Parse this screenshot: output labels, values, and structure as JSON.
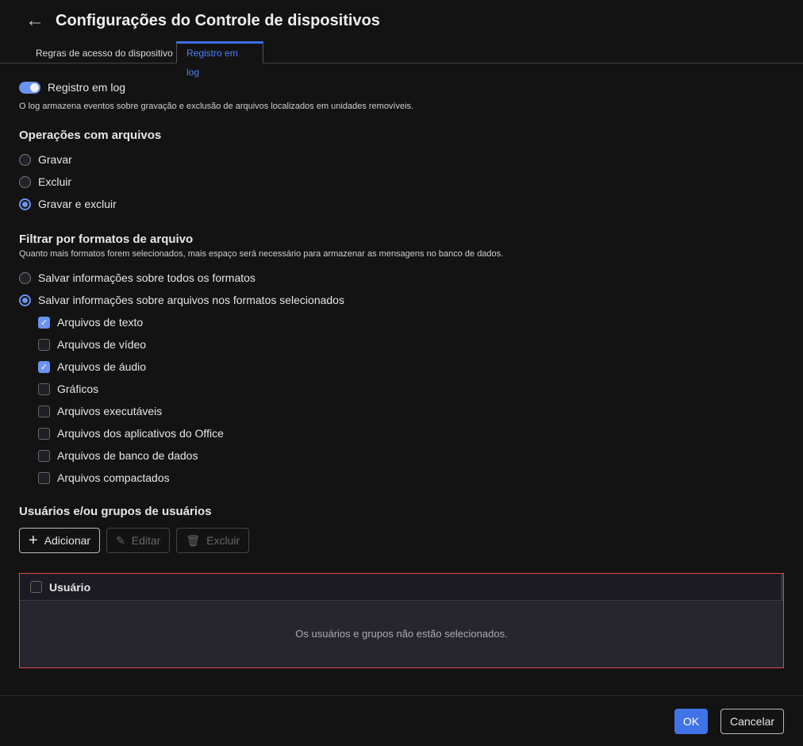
{
  "header": {
    "title": "Configurações do Controle de dispositivos"
  },
  "tabs": [
    {
      "label": "Regras de acesso do dispositivo"
    },
    {
      "label": "Registro em log"
    }
  ],
  "logging": {
    "toggle_label": "Registro em log",
    "enabled": true,
    "description": "O log armazena eventos sobre gravação e exclusão de arquivos localizados em unidades removíveis."
  },
  "operations": {
    "title": "Operações com arquivos",
    "options": [
      {
        "label": "Gravar",
        "selected": false
      },
      {
        "label": "Excluir",
        "selected": false
      },
      {
        "label": "Gravar e excluir",
        "selected": true
      }
    ]
  },
  "filter": {
    "title": "Filtrar por formatos de arquivo",
    "description": "Quanto mais formatos forem selecionados, mais espaço será necessário para armazenar as mensagens no banco de dados.",
    "options": [
      {
        "label": "Salvar informações sobre todos os formatos",
        "selected": false
      },
      {
        "label": "Salvar informações sobre arquivos nos formatos selecionados",
        "selected": true
      }
    ],
    "formats": [
      {
        "label": "Arquivos de texto",
        "checked": true
      },
      {
        "label": "Arquivos de vídeo",
        "checked": false
      },
      {
        "label": "Arquivos de áudio",
        "checked": true
      },
      {
        "label": "Gráficos",
        "checked": false
      },
      {
        "label": "Arquivos executáveis",
        "checked": false
      },
      {
        "label": "Arquivos dos aplicativos do Office",
        "checked": false
      },
      {
        "label": "Arquivos de banco de dados",
        "checked": false
      },
      {
        "label": "Arquivos compactados",
        "checked": false
      }
    ]
  },
  "users": {
    "title": "Usuários e/ou grupos de usuários",
    "add": "Adicionar",
    "edit": "Editar",
    "delete": "Excluir",
    "column": "Usuário",
    "empty": "Os usuários e grupos não estão selecionados."
  },
  "footer": {
    "ok": "OK",
    "cancel": "Cancelar"
  },
  "colors": {
    "accent": "#6b93f0",
    "primary": "#4173e8",
    "error_border": "#d94b4b"
  }
}
